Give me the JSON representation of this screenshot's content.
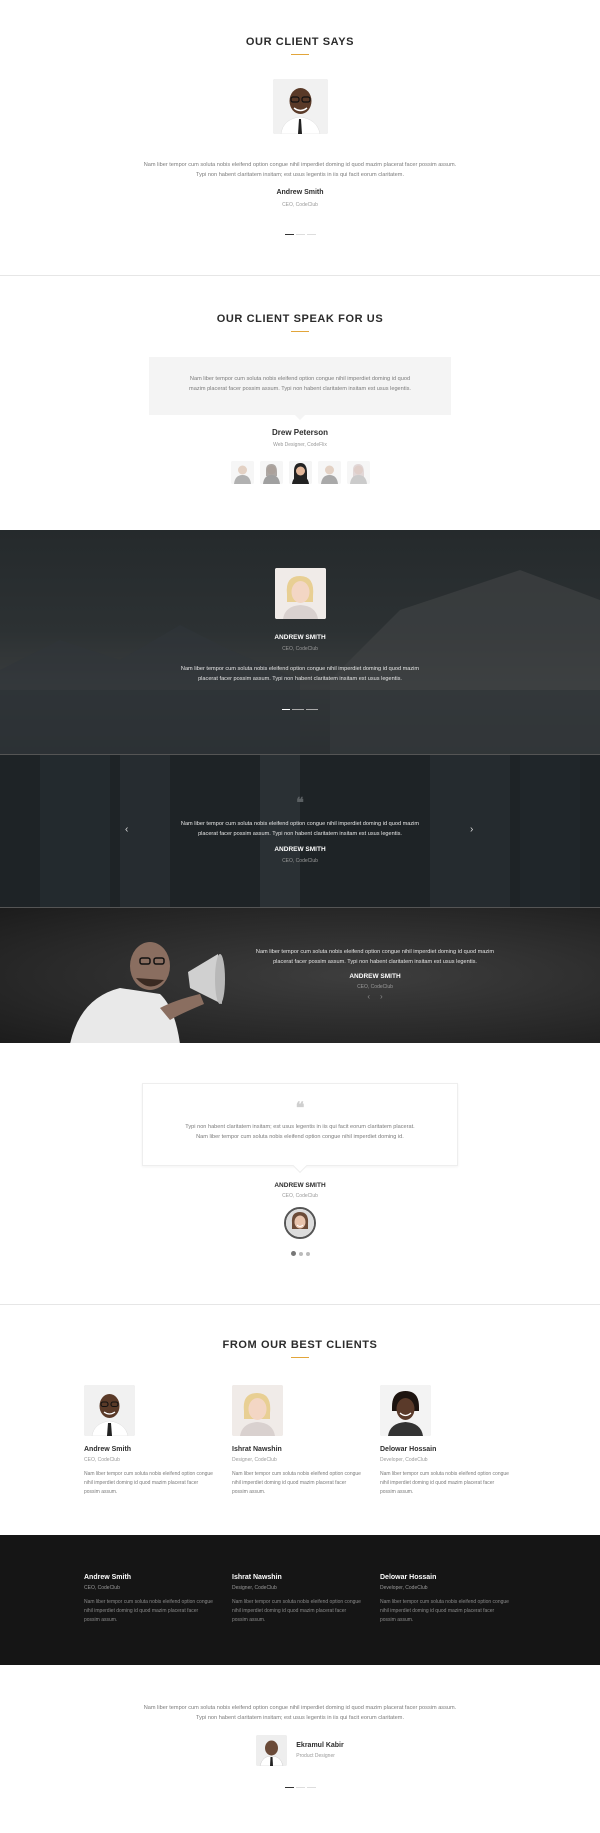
{
  "s1": {
    "title": "OUR CLIENT SAYS",
    "text1": "Nam liber tempor cum soluta nobis eleifend option congue nihil imperdiet doming id quod mazim placerat facer possim assum.",
    "text2": "Typi non habent claritatem insitam; est usus legentis in iis qui facit eorum claritatem.",
    "name": "Andrew Smith",
    "role": "CEO, CodeClub",
    "avatar_icon": "person-glasses-photo"
  },
  "s2": {
    "title": "OUR CLIENT SPEAK FOR US",
    "text1": "Nam liber tempor cum soluta nobis eleifend option congue nihil imperdiet doming id quod",
    "text2": "mazim placerat facer possim assum. Typi non habent claritatem insitam est usus legentis.",
    "name": "Drew Peterson",
    "role": "Web Designer, CodeFlix"
  },
  "s3": {
    "name": "ANDREW SMITH",
    "role": "CEO, CodeClub",
    "text1": "Nam liber tempor cum soluta nobis eleifend option congue nihil imperdiet doming id quod mazim",
    "text2": "placerat facer possim assum. Typi non habent claritatem insitam est usus legentis."
  },
  "s4": {
    "text1": "Nam liber tempor cum soluta nobis eleifend option congue nihil imperdiet doming id quod mazim",
    "text2": "placerat facer possim assum. Typi non habent claritatem insitam est usus legentis.",
    "name": "ANDREW SMITH",
    "role": "CEO, CodeClub",
    "prev_label": "‹",
    "next_label": "›",
    "quote_icon": "❝"
  },
  "s5": {
    "text1": "Nam liber tempor cum soluta nobis eleifend option congue nihil imperdiet doming id quod mazim",
    "text2": "placerat facer possim assum. Typi non habent claritatem insitam est usus legentis.",
    "name": "ANDREW SMITH",
    "role": "CEO, CodeClub",
    "prev_label": "‹",
    "next_label": "›"
  },
  "s6": {
    "quote_icon": "❝",
    "text1": "Typi non habent claritatem insitam; est usus legentis in iis qui facit eorum claritatem placerat.",
    "text2": "Nam liber tempor cum soluta nobis eleifend option congue nihil imperdiet doming id.",
    "name": "ANDREW SMITH",
    "role": "CEO, CodeClub"
  },
  "s7": {
    "title": "FROM OUR BEST CLIENTS",
    "cards": [
      {
        "name": "Andrew Smith",
        "role": "CEO, CodeClub",
        "text": "Nam liber tempor cum soluta nobis eleifend option congue nihil imperdiet doming id quod mazim placerat facer possim assum."
      },
      {
        "name": "Ishrat Nawshin",
        "role": "Designer, CodeClub",
        "text": "Nam liber tempor cum soluta nobis eleifend option congue nihil imperdiet doming id quod mazim placerat facer possim assum."
      },
      {
        "name": "Delowar Hossain",
        "role": "Developer, CodeClub",
        "text": "Nam liber tempor cum soluta nobis eleifend option congue nihil imperdiet doming id quod mazim placerat facer possim assum."
      }
    ]
  },
  "s8": {
    "cards": [
      {
        "name": "Andrew Smith",
        "role": "CEO, CodeClub",
        "text": "Nam liber tempor cum soluta nobis eleifend option congue nihil imperdiet doming id quod mazim placerat facer possim assum."
      },
      {
        "name": "Ishrat Nawshin",
        "role": "Designer, CodeClub",
        "text": "Nam liber tempor cum soluta nobis eleifend option congue nihil imperdiet doming id quod mazim placerat facer possim assum."
      },
      {
        "name": "Delowar Hossain",
        "role": "Developer, CodeClub",
        "text": "Nam liber tempor cum soluta nobis eleifend option congue nihil imperdiet doming id quod mazim placerat facer possim assum."
      }
    ]
  },
  "s9": {
    "text1": "Nam liber tempor cum soluta nobis eleifend option congue nihil imperdiet doming id quod mazim placerat facer possim assum.",
    "text2": "Typi non habent claritatem insitam; est usus legentis in iis qui facit eorum claritatem.",
    "name": "Ekramul Kabir",
    "role": "Product Designer"
  },
  "colors": {
    "accent": "#e2a53a",
    "dark": "#151515"
  }
}
